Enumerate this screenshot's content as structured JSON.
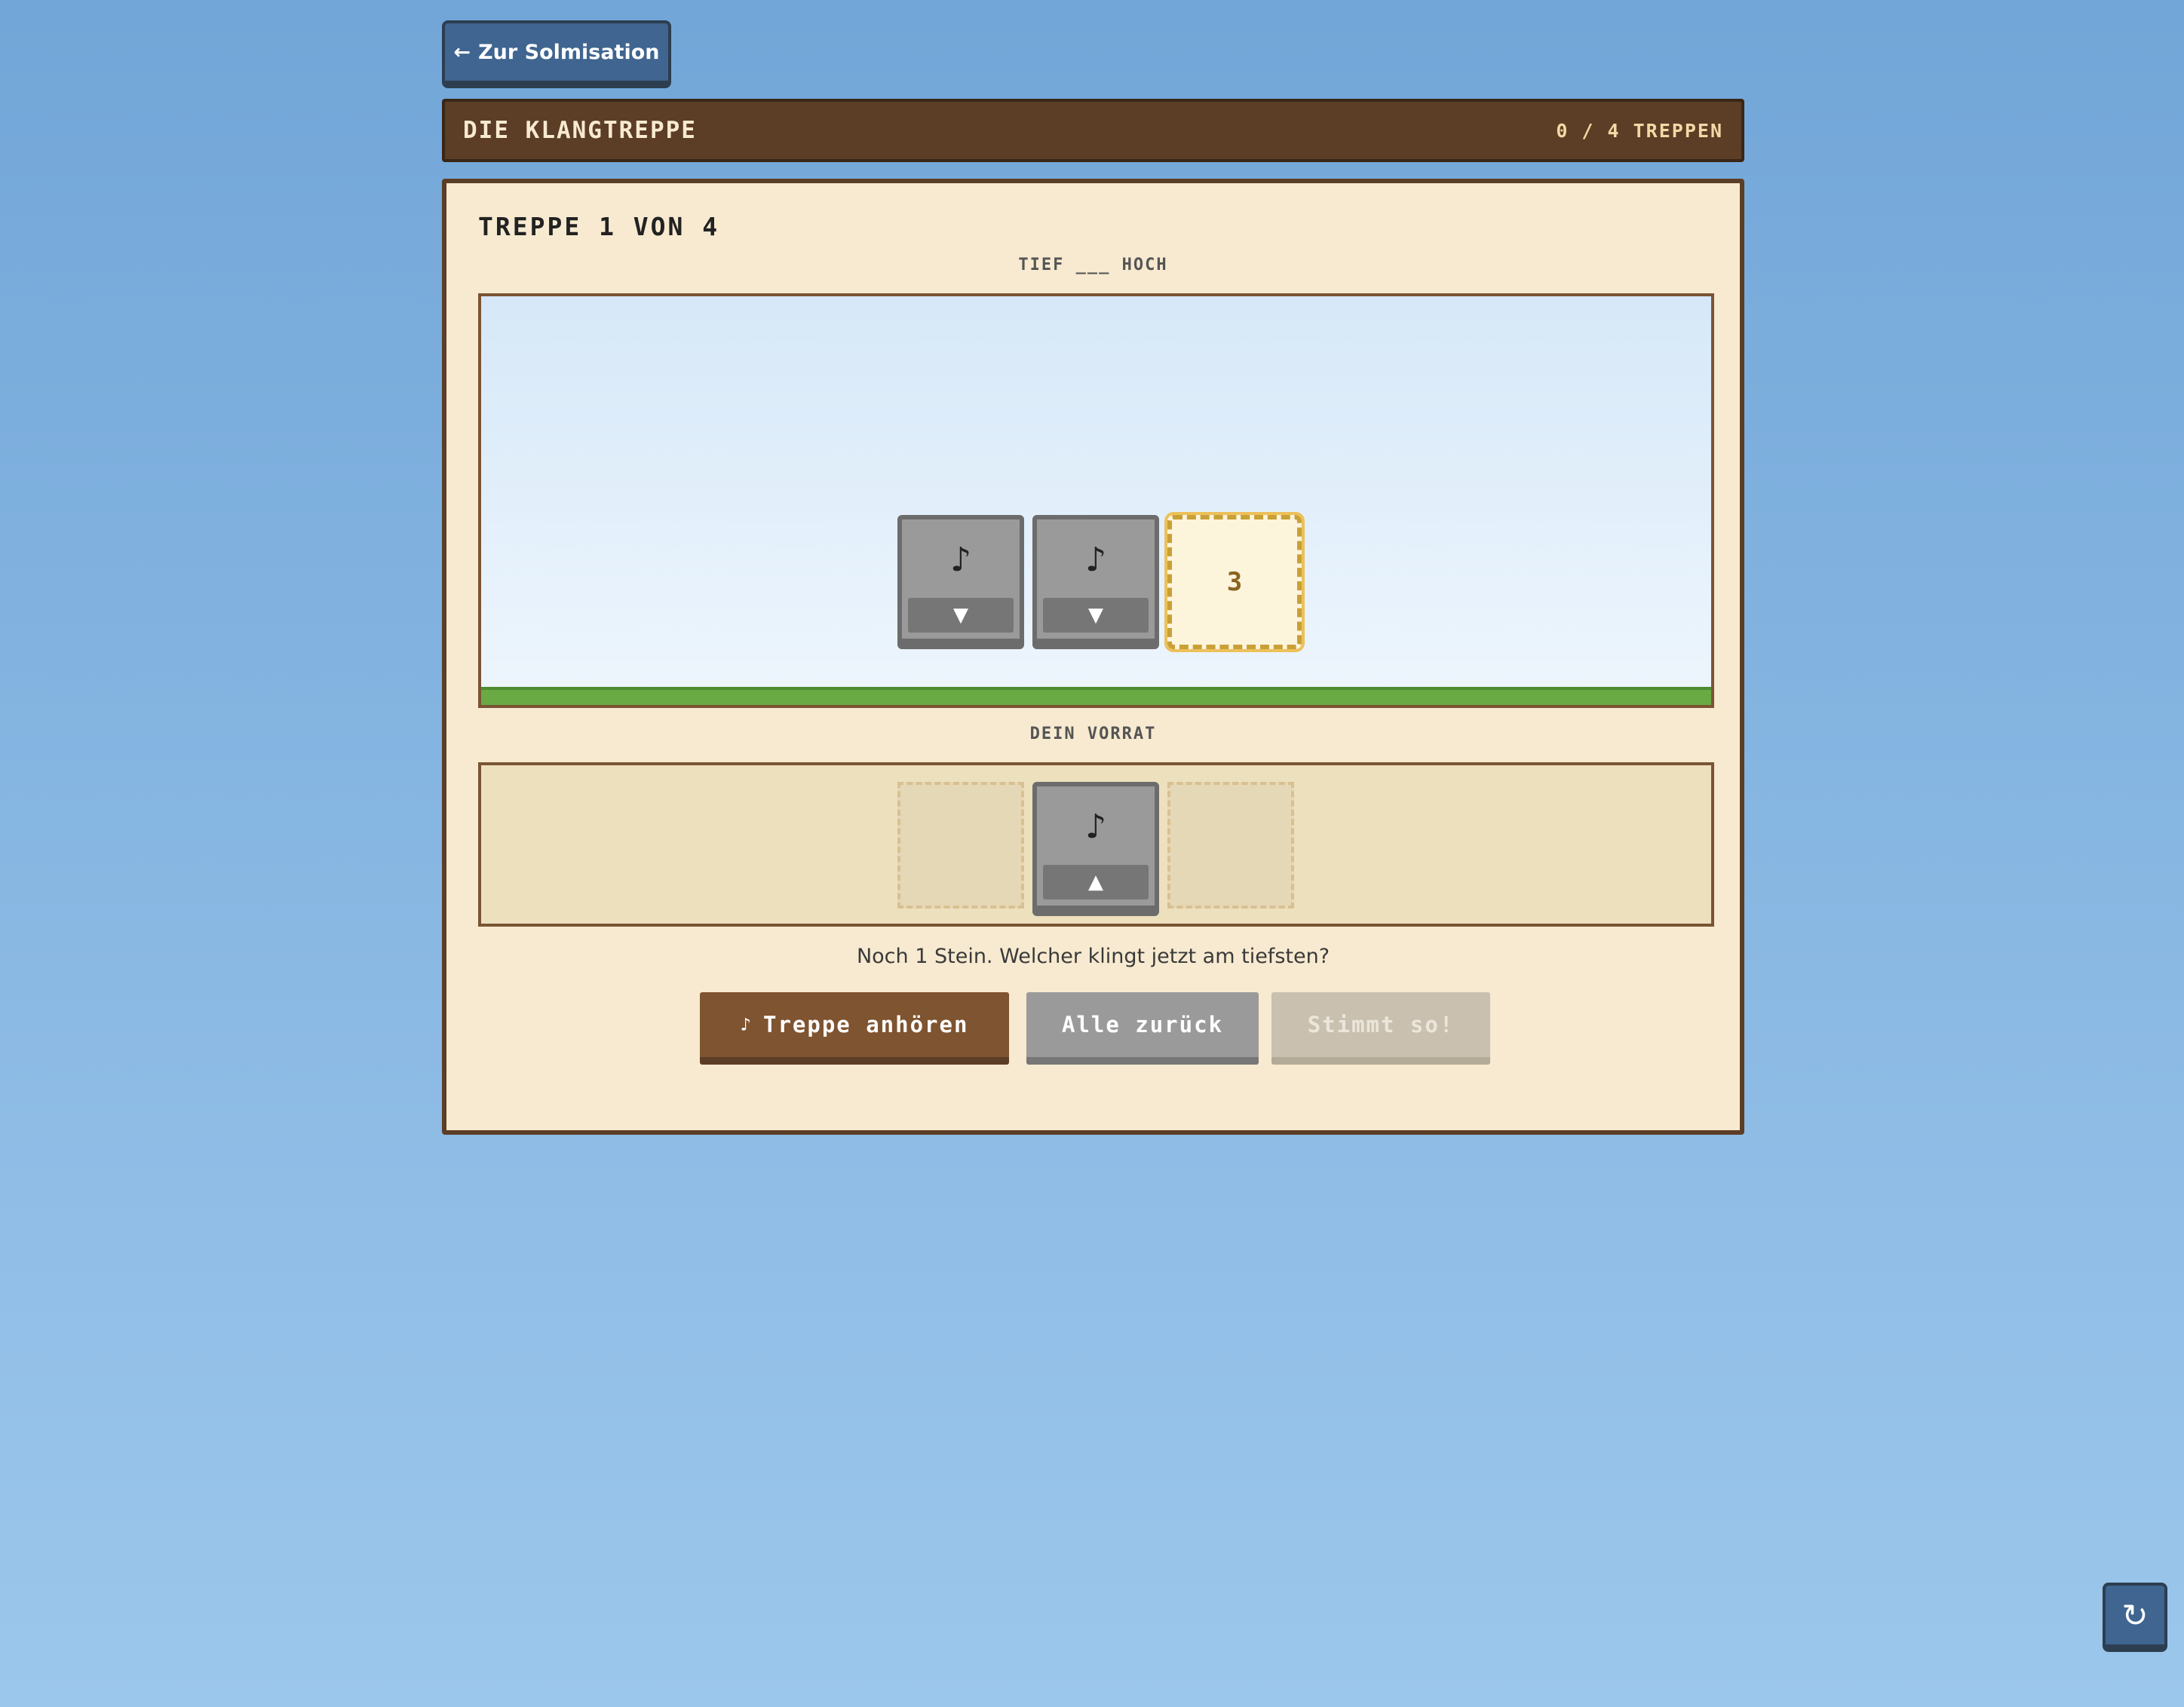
{
  "nav": {
    "back_label": "Zur Solmisation",
    "back_icon": "←"
  },
  "header": {
    "title": "DIE KLANGTREPPE",
    "progress": "0 / 4 TREPPEN"
  },
  "game": {
    "stair_title": "TREPPE 1 VON 4",
    "axis_label": "TIEF ___ HOCH",
    "placed_stones": [
      {
        "note": "♪",
        "arrow": "▼"
      },
      {
        "note": "♪",
        "arrow": "▼"
      }
    ],
    "target_slot": "3",
    "pool_label": "DEIN VORRAT",
    "pool_stone": {
      "note": "♪",
      "arrow": "▲"
    },
    "hint": "Noch 1 Stein. Welcher klingt jetzt am tiefsten?"
  },
  "actions": {
    "play_icon": "♪",
    "play_label": "Treppe anhören",
    "reset_label": "Alle zurück",
    "check_label": "Stimmt so!"
  },
  "reload_icon": "↻",
  "colors": {
    "header_brown": "#5c3d25",
    "panel_cream": "#f7ead0",
    "grass_green": "#6aaa44",
    "nav_blue": "#3f6590",
    "target_gold": "#ecc15c"
  }
}
